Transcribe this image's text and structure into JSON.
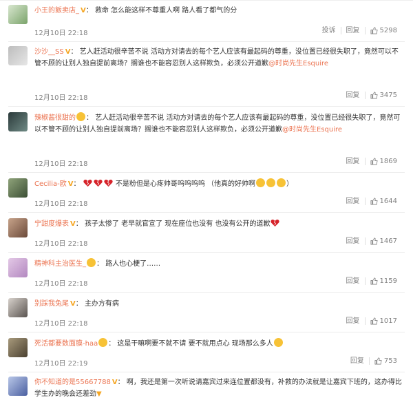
{
  "comments": [
    {
      "username": "小王的飯卖店_",
      "badge": "V",
      "text": "救命 怎么能这样不尊重人啊 路人看了都气的分",
      "time": "12月10日 22:18",
      "report": "投诉",
      "reply": "回复",
      "likes": "5298"
    },
    {
      "username": "沙沙__SS",
      "badge": "V",
      "text": "艺人赶活动很辛苦不说 活动方对请去的每个艺人应该有最起码的尊重，没位置已经很失职了，竟然可以不管不顾的让别人独自提前离场？搁谁也不能容忍别人这样欺负，必须公开道歉",
      "mention": "@时尚先生Esquire",
      "time": "12月10日 22:18",
      "reply": "回复",
      "likes": "3475"
    },
    {
      "username": "辣椒酱很甜的",
      "text": "艺人赶活动很辛苦不说 活动方对请去的每个艺人应该有最起码的尊重，没位置已经很失职了，竟然可以不管不顾的让别人独自提前离场？搁谁也不能容忍别人这样欺负，必须公开道歉",
      "mention": "@时尚先生Esquire",
      "time": "12月10日 22:18",
      "reply": "回复",
      "likes": "1869"
    },
    {
      "username": "Cecilia-欧",
      "badge": "V",
      "text": "不是粉但是心疼帅哥呜呜呜呜 （他真的好帅啊",
      "text_end": "）",
      "time": "12月10日 22:18",
      "reply": "回复",
      "likes": "1644"
    },
    {
      "username": "宁甜度爆表",
      "badge": "V",
      "text": "孩子太惨了 老早就官宣了 现在座位也没有 也没有公开的道歉",
      "time": "12月10日 22:18",
      "reply": "回复",
      "likes": "1467"
    },
    {
      "username": "精神科主治医生_",
      "text": "路人也心梗了……",
      "time": "12月10日 22:18",
      "reply": "回复",
      "likes": "1159"
    },
    {
      "username": "别踩我兔尾",
      "badge": "V",
      "text": "主办方有病",
      "time": "12月10日 22:18",
      "reply": "回复",
      "likes": "1017"
    },
    {
      "username": "死活都要数面膜-haa",
      "text": "这是干嘛啊要不就不请 要不就用点心 现场那么多人",
      "time": "12月10日 22:19",
      "reply": "回复",
      "likes": "753"
    },
    {
      "username": "你不知道的是55667788",
      "badge": "V",
      "text": "啊，我还是第一次听说请嘉宾过来连位置都没有，补救的办法就是让嘉宾下班的，这办得比学生办的晚会还差劲",
      "time": "",
      "reply": "",
      "likes": ""
    }
  ],
  "colors": {
    "username": "#eb7350",
    "text": "#333333",
    "meta": "#808080",
    "badge": "#f5a623",
    "heart": "#d6232a",
    "emoji": "#f7c236"
  }
}
